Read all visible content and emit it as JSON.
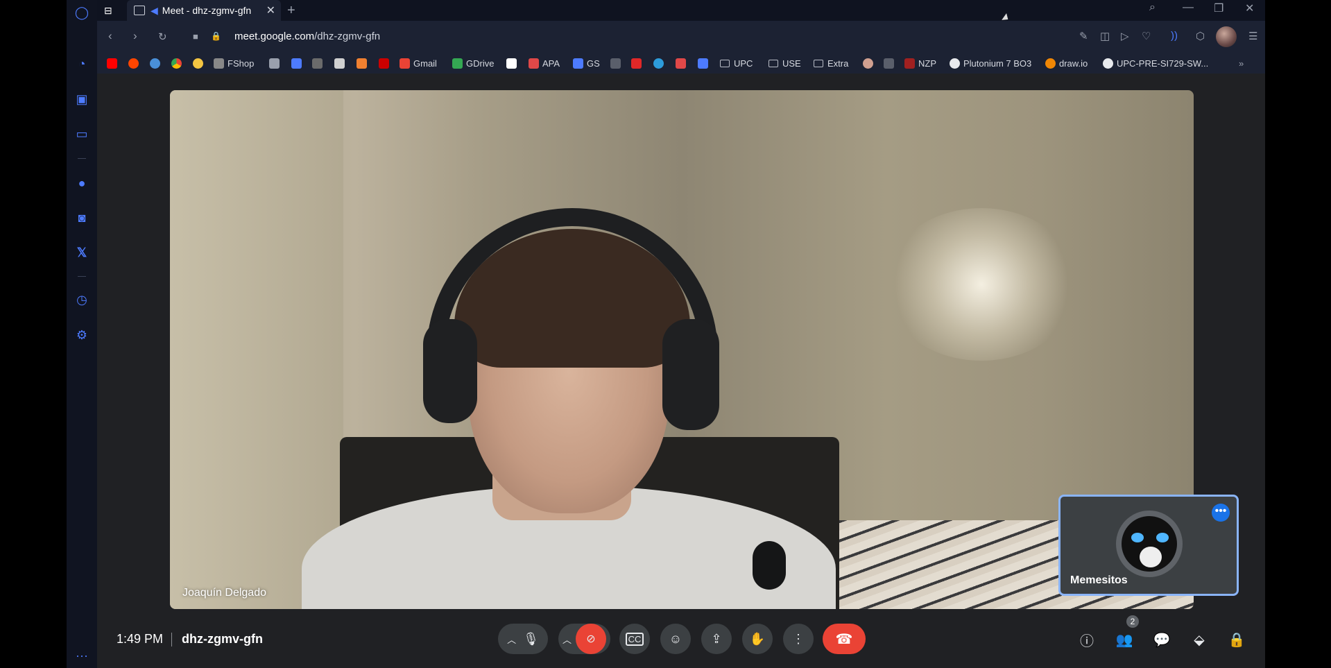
{
  "browser": {
    "tab_title": "Meet - dhz-zgmv-gfn",
    "url_host": "meet.google.com",
    "url_path": "/dhz-zgmv-gfn",
    "accent_color": "#4d7bff"
  },
  "bookmarks": [
    {
      "label": "",
      "icon": "youtube-icon",
      "color": "#ff0000"
    },
    {
      "label": "",
      "icon": "reddit-icon",
      "color": "#ff4500"
    },
    {
      "label": "",
      "icon": "steam-icon",
      "color": "#4a90d9"
    },
    {
      "label": "",
      "icon": "chrome-icon",
      "color": "#fbbc04"
    },
    {
      "label": "",
      "icon": "emoji-icon",
      "color": "#f4c542"
    },
    {
      "label": "FShop",
      "icon": "fshop-icon",
      "color": "#888888"
    },
    {
      "label": "",
      "icon": "tf-icon",
      "color": "#9aa0ad"
    },
    {
      "label": "",
      "icon": "app-icon",
      "color": "#4d7bff"
    },
    {
      "label": "",
      "icon": "item-icon",
      "color": "#6b6b6b"
    },
    {
      "label": "",
      "icon": "roblox-icon",
      "color": "#d0d0d0"
    },
    {
      "label": "",
      "icon": "pencil-icon",
      "color": "#f08030"
    },
    {
      "label": "",
      "icon": "v-icon",
      "color": "#cc0000"
    },
    {
      "label": "Gmail",
      "icon": "gmail-icon",
      "color": "#ea4335"
    },
    {
      "label": "GDrive",
      "icon": "gdrive-icon",
      "color": "#34a853"
    },
    {
      "label": "",
      "icon": "amazon-icon",
      "color": "#ffffff"
    },
    {
      "label": "APA",
      "icon": "apa-icon",
      "color": "#e04848"
    },
    {
      "label": "GS",
      "icon": "gs-icon",
      "color": "#4d7bff"
    },
    {
      "label": "",
      "icon": "arrow-icon",
      "color": "#9aa0ad"
    },
    {
      "label": "",
      "icon": "sy-icon",
      "color": "#e02828"
    },
    {
      "label": "",
      "icon": "compass-icon",
      "color": "#2d9cdb"
    },
    {
      "label": "",
      "icon": "heart-icon",
      "color": "#e04848"
    },
    {
      "label": "",
      "icon": "gem-icon",
      "color": "#4d7bff"
    },
    {
      "label": "UPC",
      "icon": "folder-icon",
      "color": ""
    },
    {
      "label": "USE",
      "icon": "folder-icon",
      "color": ""
    },
    {
      "label": "Extra",
      "icon": "folder-icon",
      "color": ""
    },
    {
      "label": "",
      "icon": "face-icon",
      "color": "#d0a090"
    },
    {
      "label": "",
      "icon": "cup-icon",
      "color": "#9aa0ad"
    },
    {
      "label": "NZP",
      "icon": "nzp-icon",
      "color": "#a02020"
    },
    {
      "label": "Plutonium 7 BO3",
      "icon": "github-icon",
      "color": ""
    },
    {
      "label": "draw.io",
      "icon": "drawio-icon",
      "color": "#f08705"
    },
    {
      "label": "UPC-PRE-SI729-SW...",
      "icon": "github-icon",
      "color": ""
    }
  ],
  "meeting": {
    "participant_name": "Joaquín Delgado",
    "self_name": "Memesitos",
    "time": "1:49 PM",
    "code": "dhz-zgmv-gfn",
    "people_count": "2",
    "end_call_color": "#ea4335",
    "self_border_color": "#8ab4f8"
  }
}
